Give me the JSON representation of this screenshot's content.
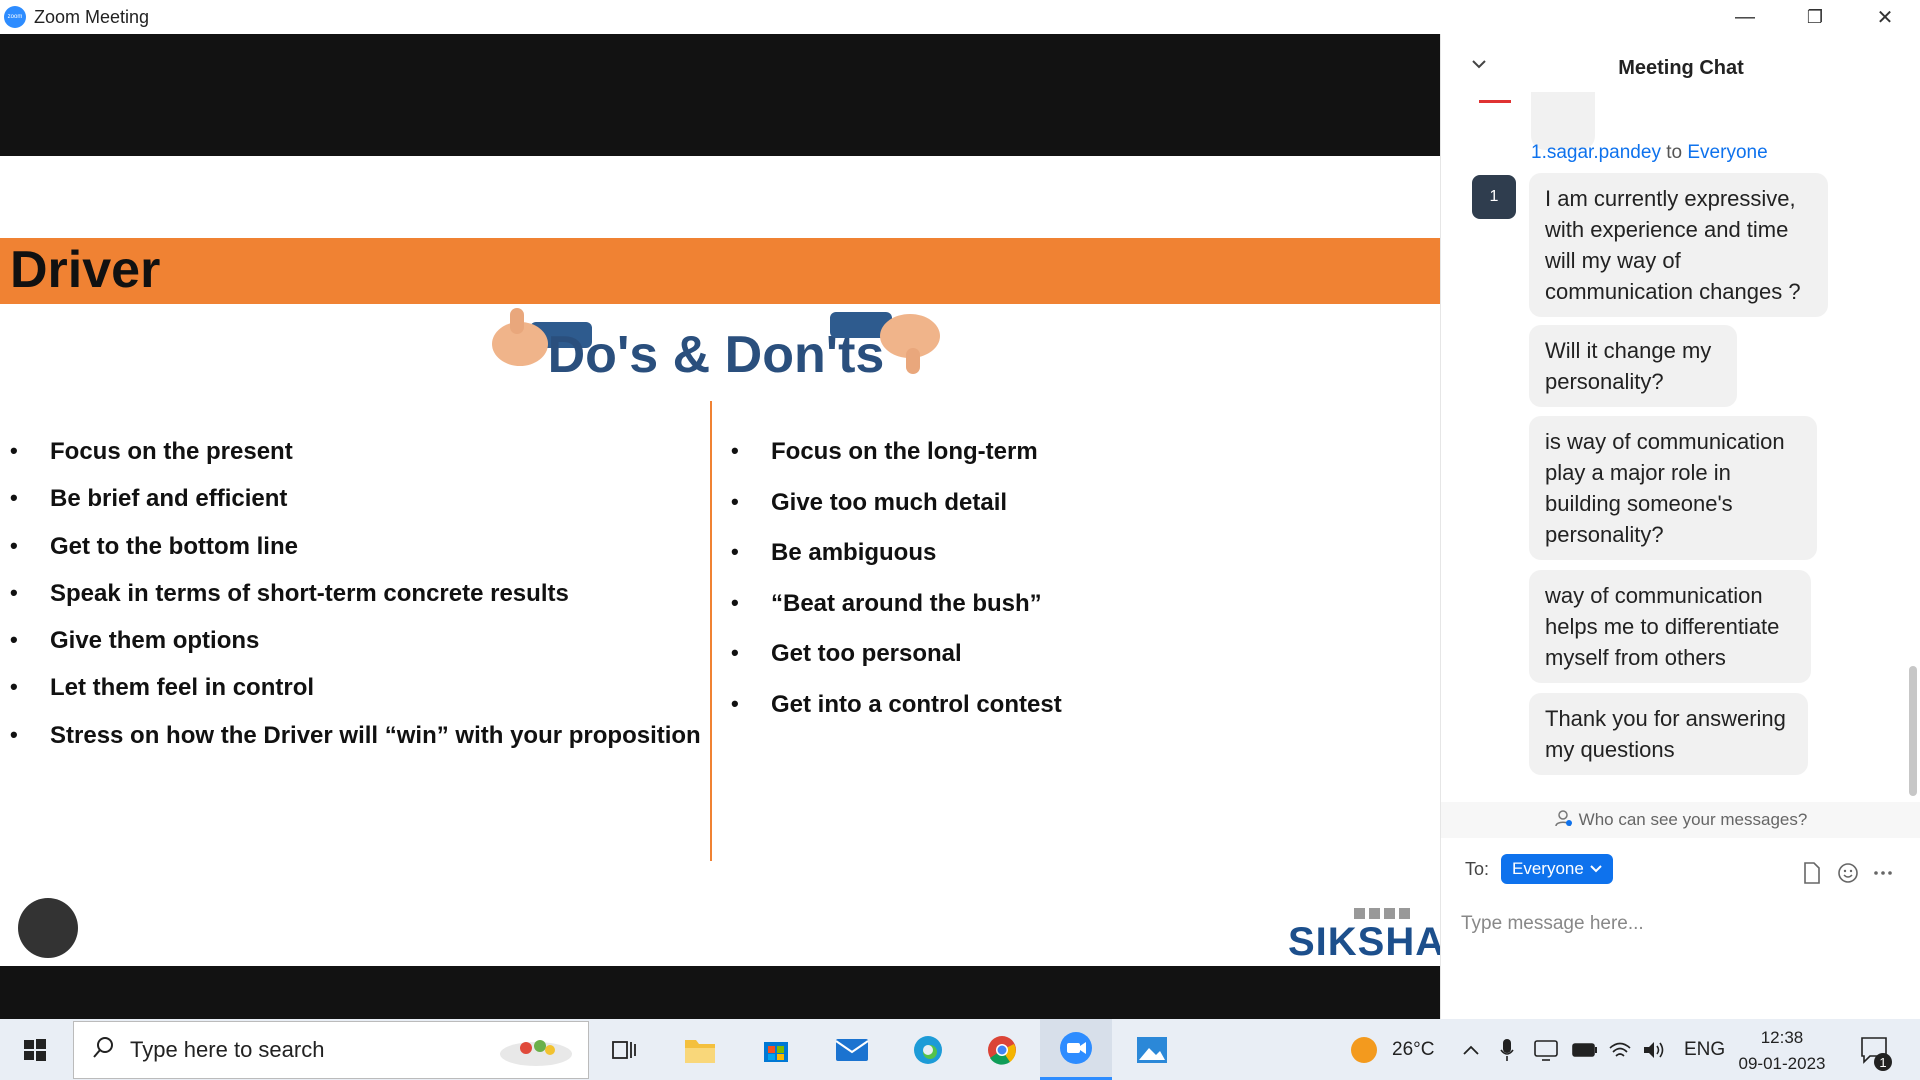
{
  "window": {
    "title": "Zoom Meeting",
    "app_logo_text": "zoom",
    "minimize": "—",
    "restore": "❐",
    "close": "✕"
  },
  "slide": {
    "title": "Driver",
    "dos_donts_label": "Do's & Don'ts",
    "dos": [
      "Focus on the present",
      "Be brief and efficient",
      "Get to the bottom line",
      "Speak in terms of short-term concrete results",
      "Give them options",
      "Let them feel in control",
      "Stress on how the Driver will “win” with your proposition"
    ],
    "donts": [
      "Focus on the long-term",
      "Give too much detail",
      "Be ambiguous",
      "“Beat around the bush”",
      "Get too personal",
      "Get into a control contest"
    ],
    "brand_logo": "SIKSHA",
    "header_color": "#f08233",
    "brand_color": "#1c4f8c"
  },
  "chat": {
    "title": "Meeting Chat",
    "sender": "1.sagar.pandey",
    "to_word": "to",
    "recipient": "Everyone",
    "avatar_initial": "1",
    "messages": [
      "I am currently expressive, with experience and time will my way of communication changes ?",
      "Will it change my personality?",
      "is way of communication play a major role in building someone's personality?",
      "way of communication helps me to differentiate myself from others",
      "Thank you for answering my questions"
    ],
    "privacy_text": "Who can see your messages?",
    "to_label": "To:",
    "to_button": "Everyone",
    "input_placeholder": "Type message here...",
    "accent_color": "#0e72ed"
  },
  "taskbar": {
    "search_placeholder": "Type here to search",
    "weather_temp": "26°C",
    "language": "ENG",
    "time": "12:38",
    "date": "09-01-2023",
    "notification_count": "1"
  }
}
